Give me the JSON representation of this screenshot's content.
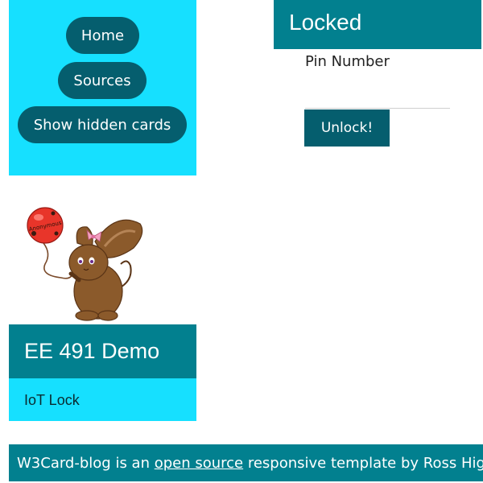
{
  "nav": {
    "home_label": "Home",
    "sources_label": "Sources",
    "show_hidden_label": "Show hidden cards"
  },
  "lock": {
    "title": "Locked",
    "pin_label": "Pin Number",
    "pin_value": "",
    "unlock_label": "Unlock!"
  },
  "demo_card": {
    "title": "EE 491 Demo",
    "subtitle": "IoT Lock",
    "balloon_text": "Anonymous"
  },
  "footer": {
    "text_before": "W3Card-blog is an ",
    "link_text": "open source",
    "text_after": " responsive template by Ross Hig"
  },
  "colors": {
    "light_cyan": "#16e0ff",
    "teal": "#02808f",
    "dark_teal": "#055e6e",
    "white": "#ffffff"
  },
  "icons": {
    "mascot": "rabbit-with-balloon"
  }
}
